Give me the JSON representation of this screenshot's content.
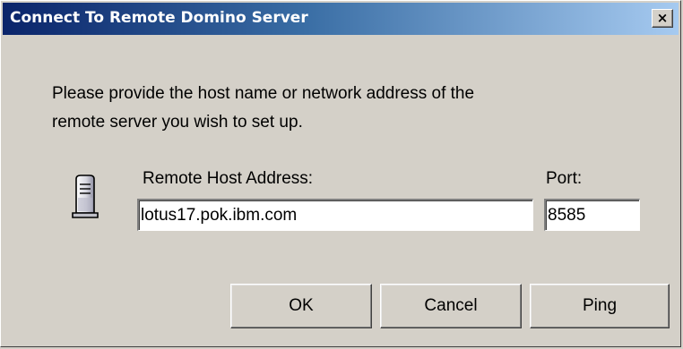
{
  "window": {
    "title": "Connect To Remote Domino Server",
    "close_label": "×"
  },
  "message": {
    "line1": "Please provide the host name or network address of the",
    "line2": "remote server you wish to set up."
  },
  "form": {
    "host_label": "Remote Host Address:",
    "host_value": "lotus17.pok.ibm.com",
    "port_label": "Port:",
    "port_value": "8585"
  },
  "buttons": {
    "ok": "OK",
    "cancel": "Cancel",
    "ping": "Ping"
  },
  "icons": {
    "server": "server-icon",
    "close": "close-icon"
  },
  "colors": {
    "titlebar_start": "#0a246a",
    "titlebar_end": "#a6caf0",
    "dialog_bg": "#d4d0c8"
  }
}
